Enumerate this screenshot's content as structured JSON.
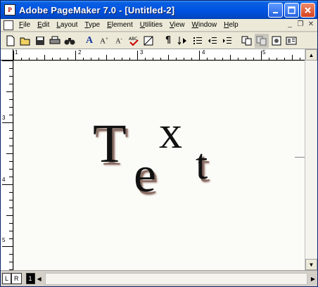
{
  "window": {
    "title": "Adobe PageMaker 7.0 - [Untitled-2]"
  },
  "menu": {
    "items": [
      "File",
      "Edit",
      "Layout",
      "Type",
      "Element",
      "Utilities",
      "View",
      "Window",
      "Help"
    ]
  },
  "ruler": {
    "top_marks": [
      "1",
      "2",
      "3",
      "4",
      "5"
    ],
    "left_marks": [
      "3",
      "4",
      "5"
    ]
  },
  "artwork": {
    "letters": [
      "T",
      "e",
      "x",
      "t"
    ]
  },
  "pages": {
    "left_label": "L",
    "right_label": "R",
    "current": "1"
  }
}
